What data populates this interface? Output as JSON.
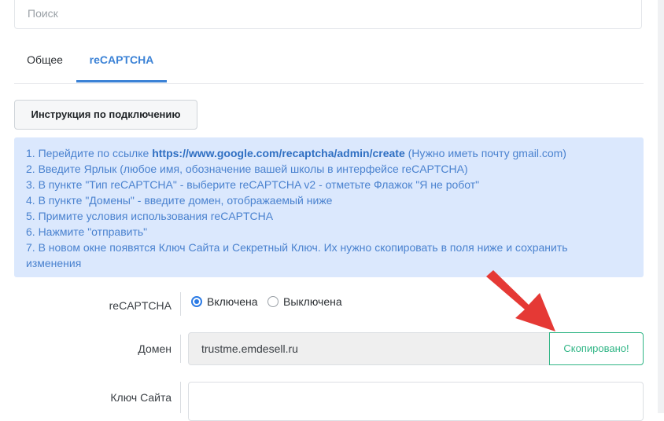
{
  "search": {
    "placeholder": "Поиск"
  },
  "tabs": [
    {
      "label": "Общее",
      "active": false
    },
    {
      "label": "reCAPTCHA",
      "active": true
    }
  ],
  "instruction_button": "Инструкция по подключению",
  "instructions": {
    "line1_prefix": "1. Перейдите по ссылке ",
    "line1_link": "https://www.google.com/recaptcha/admin/create",
    "line1_suffix": " (Нужно иметь почту gmail.com)",
    "line2": "2. Введите Ярлык (любое имя, обозначение вашей школы в интерфейсе reCAPTCHA)",
    "line3": "3. В пункте \"Тип reCAPTCHA\" - выберите reCAPTCHA v2 - отметьте Флажок \"Я не робот\"",
    "line4": "4. В пункте \"Домены\" - введите домен, отображаемый ниже",
    "line5": "5. Примите условия использования reCAPTCHA",
    "line6": "6. Нажмите \"отправить\"",
    "line7a": "7. В новом окне появятся Ключ Сайта и Секретный Ключ. Их нужно скопировать в поля ниже и сохранить",
    "line7b": "изменения"
  },
  "form": {
    "recaptcha_label": "reCAPTCHA",
    "radio_on": "Включена",
    "radio_off": "Выключена",
    "domain_label": "Домен",
    "domain_value": "trustme.emdesell.ru",
    "copied_label": "Скопировано!",
    "sitekey_label": "Ключ Сайта"
  },
  "colors": {
    "accent": "#3b82d6",
    "info_bg": "#dbe8fd",
    "success": "#2fb585",
    "arrow": "#e53935"
  }
}
